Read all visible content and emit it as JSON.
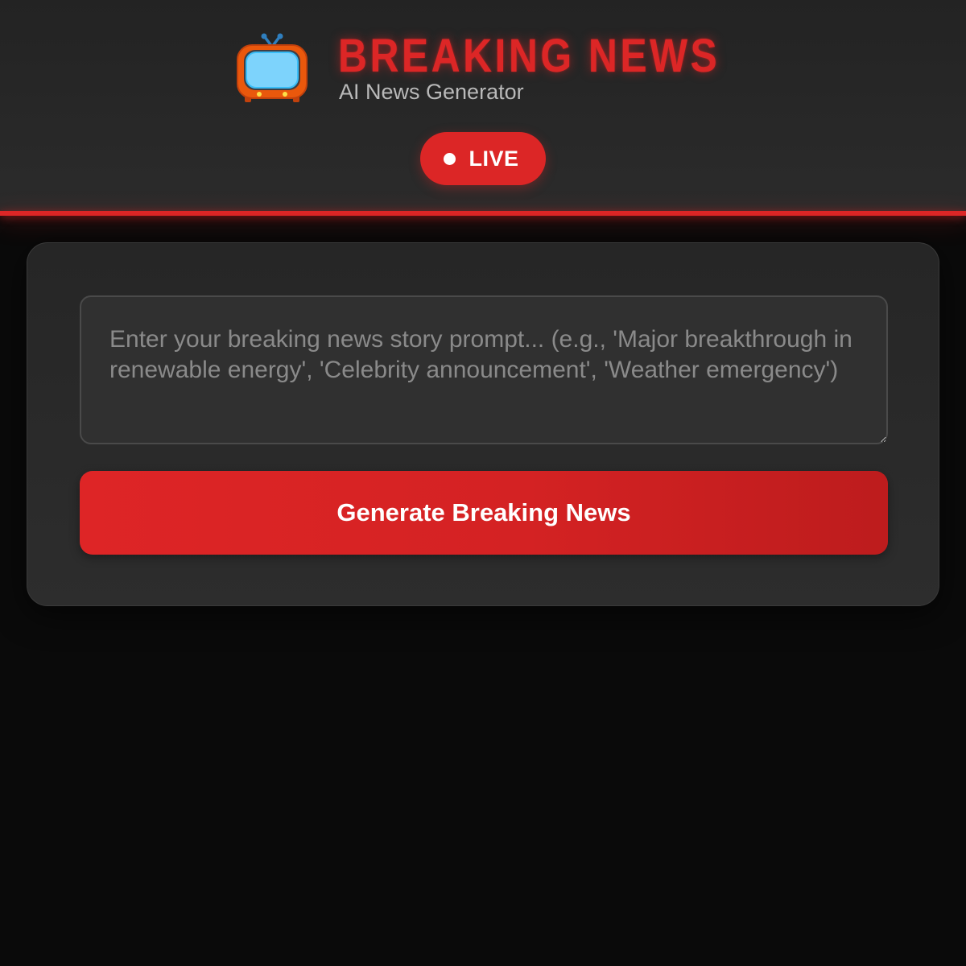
{
  "header": {
    "title": "BREAKING NEWS",
    "subtitle": "AI News Generator",
    "logo_icon": "tv-icon",
    "live_badge": {
      "label": "LIVE",
      "color": "#dc2626"
    }
  },
  "generator": {
    "prompt_value": "",
    "prompt_placeholder": "Enter your breaking news story prompt... (e.g., 'Major breakthrough in renewable energy', 'Celebrity announcement', 'Weather emergency')",
    "generate_label": "Generate Breaking News"
  },
  "colors": {
    "accent": "#dc2626",
    "background": "#0a0a0a",
    "header_background": "#2a2a2a",
    "card_background": "#2b2b2b"
  }
}
